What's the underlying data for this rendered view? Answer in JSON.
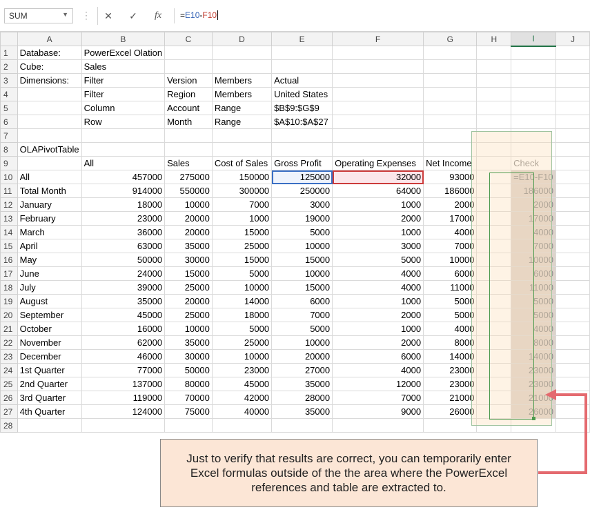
{
  "formula_bar": {
    "name_box": "SUM",
    "cancel_icon": "close-icon",
    "enter_icon": "check-icon",
    "fx_label": "fx",
    "formula_prefix": "=",
    "formula_ref_e": "E10",
    "formula_minus": "-",
    "formula_ref_f": "F10"
  },
  "columns": [
    "A",
    "B",
    "C",
    "D",
    "E",
    "F",
    "G",
    "H",
    "I",
    "J"
  ],
  "header_rows": [
    {
      "row": "1",
      "a": "Database:",
      "b": "PowerExcel Olation",
      "c": "",
      "d": "",
      "e": ""
    },
    {
      "row": "2",
      "a": "Cube:",
      "b": "Sales",
      "c": "",
      "d": "",
      "e": ""
    },
    {
      "row": "3",
      "a": "Dimensions:",
      "b": "Filter",
      "c": "Version",
      "d": "Members",
      "e": "Actual"
    },
    {
      "row": "4",
      "a": "",
      "b": "Filter",
      "c": "Region",
      "d": "Members",
      "e": "United States"
    },
    {
      "row": "5",
      "a": "",
      "b": "Column",
      "c": "Account",
      "d": "Range",
      "e": "$B$9:$G$9"
    },
    {
      "row": "6",
      "a": "",
      "b": "Row",
      "c": "Month",
      "d": "Range",
      "e": "$A$10:$A$27"
    },
    {
      "row": "7",
      "a": "",
      "b": "",
      "c": "",
      "d": "",
      "e": ""
    },
    {
      "row": "8",
      "a": "OLAPivotTable",
      "b": "",
      "c": "",
      "d": "",
      "e": ""
    }
  ],
  "table_header": {
    "row": "9",
    "a": "",
    "b": "All",
    "c": "Sales",
    "d": "Cost of Sales",
    "e": "Gross Profit",
    "f": "Operating Expenses",
    "g": "Net Income",
    "check": "Check"
  },
  "data_rows": [
    {
      "row": "10",
      "label": "All",
      "all": "457000",
      "sales": "275000",
      "cost": "150000",
      "gp": "125000",
      "opex": "32000",
      "ni": "93000",
      "check": "=E10-F10"
    },
    {
      "row": "11",
      "label": "Total Month",
      "all": "914000",
      "sales": "550000",
      "cost": "300000",
      "gp": "250000",
      "opex": "64000",
      "ni": "186000",
      "check": "186000"
    },
    {
      "row": "12",
      "label": "January",
      "all": "18000",
      "sales": "10000",
      "cost": "7000",
      "gp": "3000",
      "opex": "1000",
      "ni": "2000",
      "check": "2000"
    },
    {
      "row": "13",
      "label": "February",
      "all": "23000",
      "sales": "20000",
      "cost": "1000",
      "gp": "19000",
      "opex": "2000",
      "ni": "17000",
      "check": "17000"
    },
    {
      "row": "14",
      "label": "March",
      "all": "36000",
      "sales": "20000",
      "cost": "15000",
      "gp": "5000",
      "opex": "1000",
      "ni": "4000",
      "check": "4000"
    },
    {
      "row": "15",
      "label": "April",
      "all": "63000",
      "sales": "35000",
      "cost": "25000",
      "gp": "10000",
      "opex": "3000",
      "ni": "7000",
      "check": "7000"
    },
    {
      "row": "16",
      "label": "May",
      "all": "50000",
      "sales": "30000",
      "cost": "15000",
      "gp": "15000",
      "opex": "5000",
      "ni": "10000",
      "check": "10000"
    },
    {
      "row": "17",
      "label": "June",
      "all": "24000",
      "sales": "15000",
      "cost": "5000",
      "gp": "10000",
      "opex": "4000",
      "ni": "6000",
      "check": "6000"
    },
    {
      "row": "18",
      "label": "July",
      "all": "39000",
      "sales": "25000",
      "cost": "10000",
      "gp": "15000",
      "opex": "4000",
      "ni": "11000",
      "check": "11000"
    },
    {
      "row": "19",
      "label": "August",
      "all": "35000",
      "sales": "20000",
      "cost": "14000",
      "gp": "6000",
      "opex": "1000",
      "ni": "5000",
      "check": "5000"
    },
    {
      "row": "20",
      "label": "September",
      "all": "45000",
      "sales": "25000",
      "cost": "18000",
      "gp": "7000",
      "opex": "2000",
      "ni": "5000",
      "check": "5000"
    },
    {
      "row": "21",
      "label": "October",
      "all": "16000",
      "sales": "10000",
      "cost": "5000",
      "gp": "5000",
      "opex": "1000",
      "ni": "4000",
      "check": "4000"
    },
    {
      "row": "22",
      "label": "November",
      "all": "62000",
      "sales": "35000",
      "cost": "25000",
      "gp": "10000",
      "opex": "2000",
      "ni": "8000",
      "check": "8000"
    },
    {
      "row": "23",
      "label": "December",
      "all": "46000",
      "sales": "30000",
      "cost": "10000",
      "gp": "20000",
      "opex": "6000",
      "ni": "14000",
      "check": "14000"
    },
    {
      "row": "24",
      "label": "1st Quarter",
      "all": "77000",
      "sales": "50000",
      "cost": "23000",
      "gp": "27000",
      "opex": "4000",
      "ni": "23000",
      "check": "23000"
    },
    {
      "row": "25",
      "label": "2nd Quarter",
      "all": "137000",
      "sales": "80000",
      "cost": "45000",
      "gp": "35000",
      "opex": "12000",
      "ni": "23000",
      "check": "23000"
    },
    {
      "row": "26",
      "label": "3rd Quarter",
      "all": "119000",
      "sales": "70000",
      "cost": "42000",
      "gp": "28000",
      "opex": "7000",
      "ni": "21000",
      "check": "21000"
    },
    {
      "row": "27",
      "label": "4th Quarter",
      "all": "124000",
      "sales": "75000",
      "cost": "40000",
      "gp": "35000",
      "opex": "9000",
      "ni": "26000",
      "check": "26000"
    }
  ],
  "last_row": "28",
  "callout": {
    "text": "Just to verify that results are correct, you can temporarily enter Excel formulas outside of the the area where the PowerExcel references and table are extracted to."
  },
  "colors": {
    "selected_col_accent": "#217346",
    "ref_e": "#3a6fc4",
    "ref_f": "#cc3b3b",
    "arrow": "#e46a6f",
    "callout_bg": "#fce6d6"
  }
}
